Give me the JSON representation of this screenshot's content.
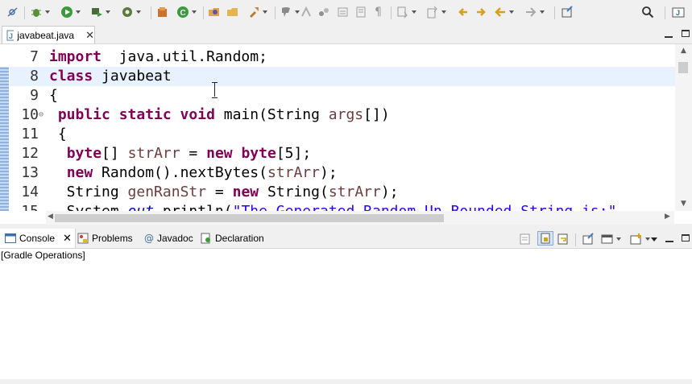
{
  "toolbar": {
    "icons": [
      "skip-breakpoints-icon",
      "debug-icon",
      "run-icon",
      "external-tools-icon",
      "new-java-package-icon",
      "new-java-class-icon",
      "open-type-icon",
      "open-task-icon",
      "search-icon",
      "annotation-icon",
      "toggle-mark-occurrences-icon",
      "toggle-block-selection-icon",
      "show-whitespace-icon",
      "next-annotation-icon",
      "previous-annotation-icon",
      "last-edit-location-icon",
      "back-icon",
      "forward-icon",
      "pin-editor-icon",
      "quick-access-search-icon",
      "java-perspective-icon"
    ]
  },
  "editor": {
    "tab_label": "javabeat.java",
    "lines": [
      {
        "num": "7",
        "tokens": [
          [
            "kw",
            "import"
          ],
          [
            "",
            "  java.util.Random;"
          ]
        ]
      },
      {
        "num": "8",
        "tokens": [
          [
            "kw",
            "class"
          ],
          [
            "",
            " javabeat"
          ]
        ]
      },
      {
        "num": "9",
        "tokens": [
          [
            "",
            "{"
          ]
        ]
      },
      {
        "num": "10",
        "fold": true,
        "tokens": [
          [
            "",
            ""
          ],
          [
            "kw",
            " public static void"
          ],
          [
            "",
            " main(String "
          ],
          [
            "var",
            "args"
          ],
          [
            "",
            "[])"
          ]
        ]
      },
      {
        "num": "11",
        "tokens": [
          [
            "",
            ""
          ],
          [
            "",
            ""
          ],
          [
            "",
            " {"
          ]
        ]
      },
      {
        "num": "12",
        "tokens": [
          [
            "",
            "  "
          ],
          [
            "kw",
            "byte"
          ],
          [
            "",
            "[] "
          ],
          [
            "var",
            "strArr"
          ],
          [
            "",
            " = "
          ],
          [
            "kw",
            "new"
          ],
          [
            "",
            " "
          ],
          [
            "kw",
            "byte"
          ],
          [
            "",
            "[5];"
          ]
        ]
      },
      {
        "num": "13",
        "tokens": [
          [
            "",
            "  "
          ],
          [
            "kw",
            "new"
          ],
          [
            "",
            " Random().nextBytes("
          ],
          [
            "var",
            "strArr"
          ],
          [
            "",
            ");"
          ]
        ]
      },
      {
        "num": "14",
        "tokens": [
          [
            "",
            "  String "
          ],
          [
            "var",
            "genRanStr"
          ],
          [
            "",
            " = "
          ],
          [
            "kw",
            "new"
          ],
          [
            "",
            " String("
          ],
          [
            "var",
            "strArr"
          ],
          [
            "",
            ");"
          ]
        ]
      },
      {
        "num": "15",
        "tokens": [
          [
            "",
            "  System."
          ],
          [
            "fld",
            "out"
          ],
          [
            "",
            ".println("
          ],
          [
            "str",
            "\"The Generated Random Un-Bounded String is:\""
          ]
        ]
      }
    ]
  },
  "console": {
    "tabs": [
      {
        "label": "Console",
        "icon": "console-icon"
      },
      {
        "label": "Problems",
        "icon": "problems-icon"
      },
      {
        "label": "Javadoc",
        "icon": "javadoc-icon"
      },
      {
        "label": "Declaration",
        "icon": "declaration-icon"
      }
    ],
    "header": "[Gradle Operations]"
  }
}
